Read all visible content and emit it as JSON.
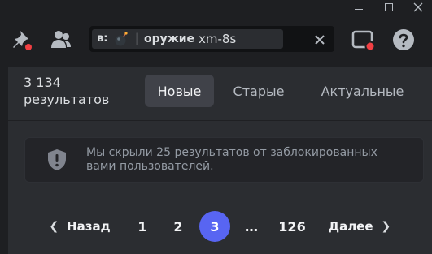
{
  "toolbar": {
    "search": {
      "filter_prefix": "в:",
      "filter_separator": "|",
      "filter_value": "оружие",
      "query": "xm-8s"
    }
  },
  "results": {
    "count_line1": "3 134",
    "count_line2": "результатов"
  },
  "tabs": [
    {
      "label": "Новые",
      "selected": true
    },
    {
      "label": "Старые",
      "selected": false
    },
    {
      "label": "Актуальные",
      "selected": false
    }
  ],
  "notice": {
    "text": "Мы скрыли 25 результатов от заблокированных вами пользователей."
  },
  "pagination": {
    "prev_label": "Назад",
    "next_label": "Далее",
    "pages": [
      "1",
      "2",
      "3",
      "…",
      "126"
    ],
    "current_page": "3"
  },
  "colors": {
    "accent": "#5865f2",
    "badge_red": "#f23f43",
    "background": "#2b2d31",
    "toolbar": "#1e1f22"
  }
}
